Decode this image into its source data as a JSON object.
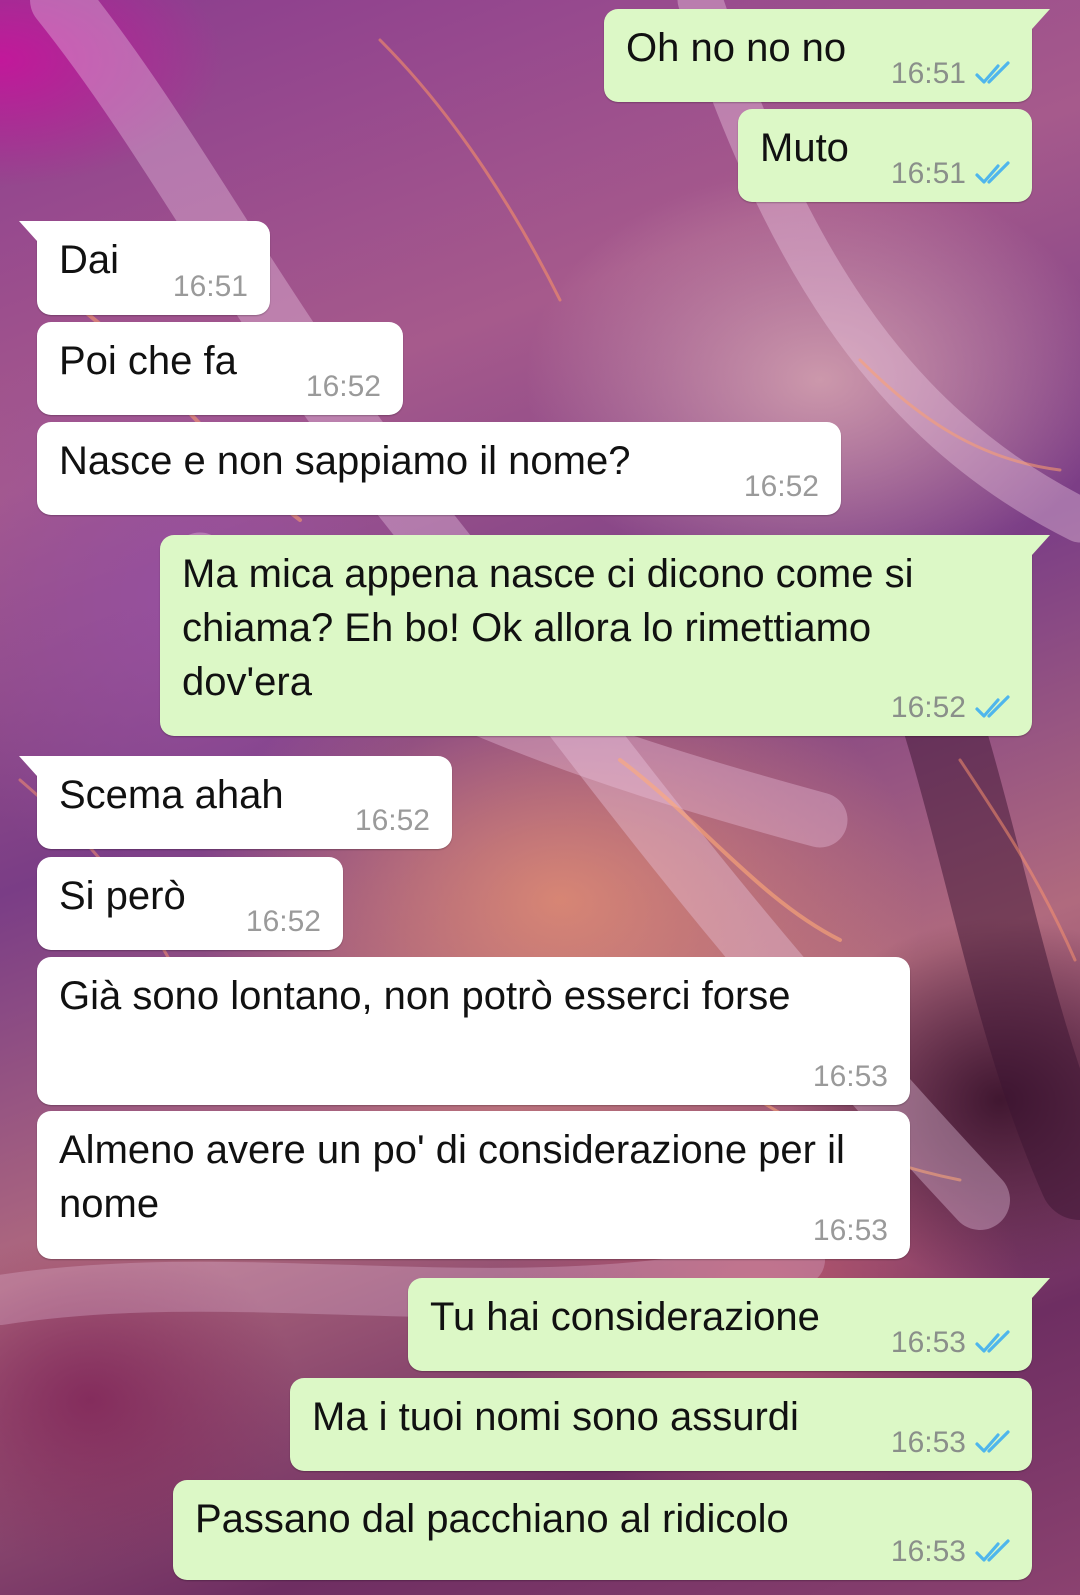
{
  "chat": {
    "messages": [
      {
        "direction": "out",
        "text": "Oh no no no",
        "time": "16:51",
        "status_icon": "double-check-read-icon"
      },
      {
        "direction": "out",
        "text": "Muto",
        "time": "16:51",
        "status_icon": "double-check-read-icon"
      },
      {
        "direction": "in",
        "text": "Dai",
        "time": "16:51"
      },
      {
        "direction": "in",
        "text": "Poi che fa",
        "time": "16:52"
      },
      {
        "direction": "in",
        "text": "Nasce e non sappiamo il nome?",
        "time": "16:52"
      },
      {
        "direction": "out",
        "text": "Ma mica appena nasce ci dicono come si chiama? Eh bo! Ok allora lo rimettiamo dov'era",
        "time": "16:52",
        "status_icon": "double-check-read-icon"
      },
      {
        "direction": "in",
        "text": "Scema ahah",
        "time": "16:52"
      },
      {
        "direction": "in",
        "text": "Si però",
        "time": "16:52"
      },
      {
        "direction": "in",
        "text": "Già sono lontano, non potrò esserci forse",
        "time": "16:53"
      },
      {
        "direction": "in",
        "text": "Almeno avere un po' di considerazione per il nome",
        "time": "16:53"
      },
      {
        "direction": "out",
        "text": "Tu hai considerazione",
        "time": "16:53",
        "status_icon": "double-check-read-icon"
      },
      {
        "direction": "out",
        "text": "Ma i tuoi nomi sono assurdi",
        "time": "16:53",
        "status_icon": "double-check-read-icon"
      },
      {
        "direction": "out",
        "text": "Passano dal pacchiano al ridicolo",
        "time": "16:53",
        "status_icon": "double-check-read-icon"
      }
    ]
  },
  "colors": {
    "outgoing_bubble": "#dcf8c6",
    "incoming_bubble": "#ffffff",
    "read_tick": "#4fb6ec",
    "timestamp": "#8a8f8a"
  }
}
